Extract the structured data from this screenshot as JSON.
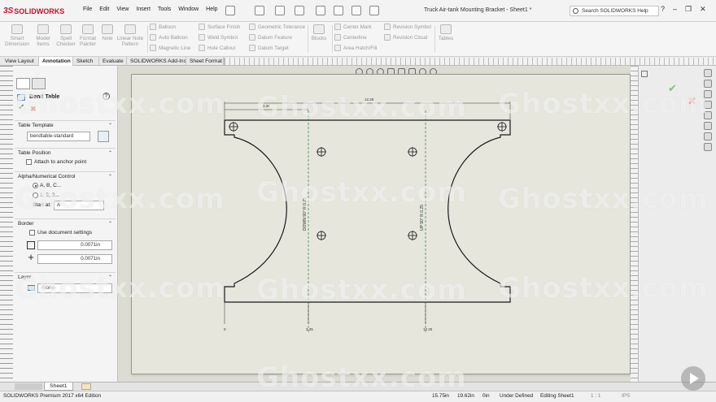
{
  "app": {
    "brand": "SOLIDWORKS",
    "brand_prefix": "3S",
    "title": "Truck Air-tank Mounting Bracket - Sheet1 *"
  },
  "menu": [
    "File",
    "Edit",
    "View",
    "Insert",
    "Tools",
    "Window",
    "Help"
  ],
  "search": {
    "placeholder": "Search SOLIDWORKS Help"
  },
  "window_controls": [
    "?",
    "–",
    "❐",
    "✕"
  ],
  "command_manager": {
    "large_tools": [
      "Smart Dimension",
      "Model Items",
      "Spell Checker",
      "Format Painter",
      "Note",
      "Linear Note Pattern",
      "Blocks",
      "Tables"
    ],
    "small_tools": [
      "Balloon",
      "Auto Balloon",
      "Magnetic Line",
      "Surface Finish",
      "Weld Symbol",
      "Hole Callout",
      "Geometric Tolerance",
      "Datum Feature",
      "Datum Target",
      "Center Mark",
      "Centerline",
      "Area Hatch/Fill",
      "Revision Symbol",
      "Revision Cloud"
    ]
  },
  "tabs": [
    "View Layout",
    "Annotation",
    "Sketch",
    "Evaluate",
    "SOLIDWORKS Add-Ins",
    "Sheet Format"
  ],
  "active_tab": "Annotation",
  "property_manager": {
    "title": "Bend Table",
    "sections": {
      "template": {
        "label": "Table Template",
        "value": "bendtable-standard"
      },
      "position": {
        "label": "Table Position",
        "attach_label": "Attach to anchor point"
      },
      "alpha": {
        "label": "Alpha/Numerical Control",
        "opt1": "A, B, C...",
        "opt2": "1, 2, 3...",
        "start_label": "Start at:",
        "start_value": "A"
      },
      "border": {
        "label": "Border",
        "doc_settings_label": "Use document settings",
        "width1": "0.0071in",
        "width2": "0.0071in"
      },
      "layer": {
        "label": "Layer",
        "value": "-None-"
      }
    }
  },
  "drawing": {
    "dim_top_overall": "12.25",
    "dim_top_partial": "3.25",
    "bend_label_left": "DOWN 90° R 0.25",
    "bend_label_right": "UP 90° R 0.25",
    "bottom_dim_left": "0",
    "bottom_dim_mid": "3.25",
    "bottom_dim_right": "12.25"
  },
  "sheet_tab": "Sheet1",
  "status": {
    "edition": "SOLIDWORKS Premium 2017 x64 Edition",
    "x": "15.75in",
    "y": "19.62in",
    "z": "0in",
    "state": "Under Defined",
    "editing": "Editing Sheet1",
    "scale": "1 : 1",
    "units": "IPS"
  },
  "watermark": "Ghostxx.com",
  "colors": {
    "brand_red": "#c8102e",
    "bend_line": "#2e7d32",
    "sheet": "#e6e6dd"
  }
}
